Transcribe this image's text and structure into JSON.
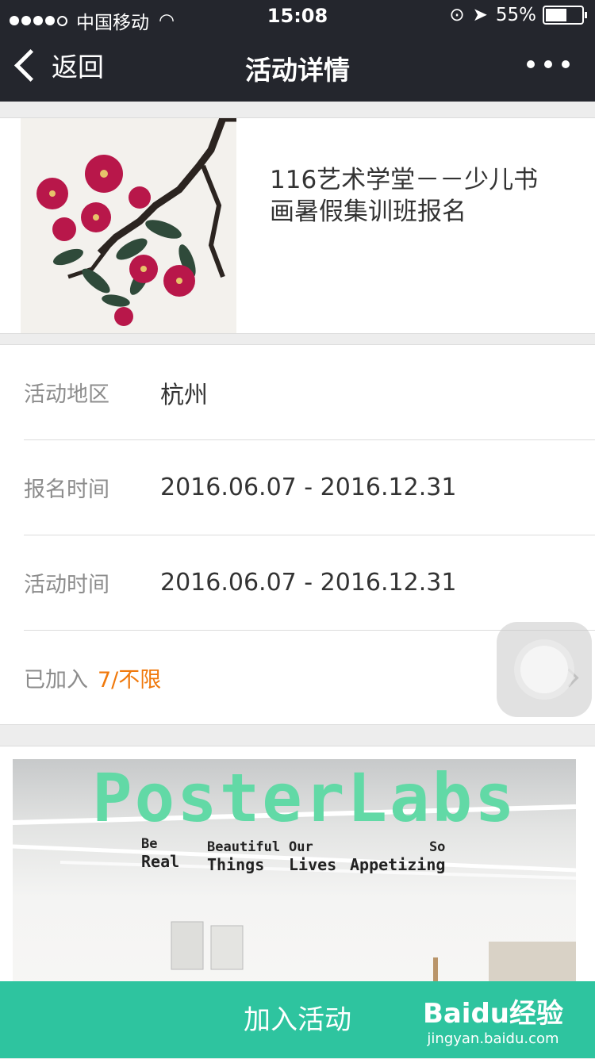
{
  "status_bar": {
    "carrier": "中国移动",
    "time": "15:08",
    "battery": "55%"
  },
  "nav": {
    "back_label": "返回",
    "title": "活动详情"
  },
  "event": {
    "title": "116艺术学堂－－少儿书画暑假集训班报名"
  },
  "info": {
    "region_label": "活动地区",
    "region_value": "杭州",
    "signup_label": "报名时间",
    "signup_value": "2016.06.07  - 2016.12.31",
    "activity_label": "活动时间",
    "activity_value": "2016.06.07  - 2016.12.31",
    "joined_label": "已加入",
    "joined_value": "7/不限"
  },
  "poster": {
    "brand": "PosterLabs",
    "tags": [
      {
        "small": "Be",
        "big": "Real"
      },
      {
        "small": "Beautiful",
        "big": "Things"
      },
      {
        "small": "Our",
        "big": "Lives"
      },
      {
        "small": "So",
        "big": "Appetizing"
      }
    ]
  },
  "footer": {
    "join_label": "加入活动",
    "watermark_logo": "Baidu经验",
    "watermark_sub": "jingyan.baidu.com"
  },
  "colors": {
    "nav_bg": "#24262d",
    "accent": "#2ec49f",
    "count": "#f0790c"
  }
}
